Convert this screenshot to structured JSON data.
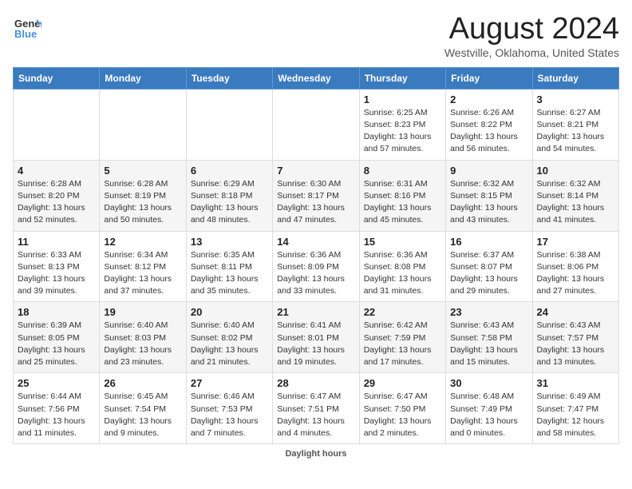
{
  "header": {
    "logo_line1": "General",
    "logo_line2": "Blue",
    "title": "August 2024",
    "subtitle": "Westville, Oklahoma, United States"
  },
  "days_of_week": [
    "Sunday",
    "Monday",
    "Tuesday",
    "Wednesday",
    "Thursday",
    "Friday",
    "Saturday"
  ],
  "footer": {
    "note": "Daylight hours"
  },
  "weeks": [
    {
      "days": [
        {
          "number": "",
          "info": ""
        },
        {
          "number": "",
          "info": ""
        },
        {
          "number": "",
          "info": ""
        },
        {
          "number": "",
          "info": ""
        },
        {
          "number": "1",
          "info": "Sunrise: 6:25 AM\nSunset: 8:23 PM\nDaylight: 13 hours\nand 57 minutes."
        },
        {
          "number": "2",
          "info": "Sunrise: 6:26 AM\nSunset: 8:22 PM\nDaylight: 13 hours\nand 56 minutes."
        },
        {
          "number": "3",
          "info": "Sunrise: 6:27 AM\nSunset: 8:21 PM\nDaylight: 13 hours\nand 54 minutes."
        }
      ]
    },
    {
      "days": [
        {
          "number": "4",
          "info": "Sunrise: 6:28 AM\nSunset: 8:20 PM\nDaylight: 13 hours\nand 52 minutes."
        },
        {
          "number": "5",
          "info": "Sunrise: 6:28 AM\nSunset: 8:19 PM\nDaylight: 13 hours\nand 50 minutes."
        },
        {
          "number": "6",
          "info": "Sunrise: 6:29 AM\nSunset: 8:18 PM\nDaylight: 13 hours\nand 48 minutes."
        },
        {
          "number": "7",
          "info": "Sunrise: 6:30 AM\nSunset: 8:17 PM\nDaylight: 13 hours\nand 47 minutes."
        },
        {
          "number": "8",
          "info": "Sunrise: 6:31 AM\nSunset: 8:16 PM\nDaylight: 13 hours\nand 45 minutes."
        },
        {
          "number": "9",
          "info": "Sunrise: 6:32 AM\nSunset: 8:15 PM\nDaylight: 13 hours\nand 43 minutes."
        },
        {
          "number": "10",
          "info": "Sunrise: 6:32 AM\nSunset: 8:14 PM\nDaylight: 13 hours\nand 41 minutes."
        }
      ]
    },
    {
      "days": [
        {
          "number": "11",
          "info": "Sunrise: 6:33 AM\nSunset: 8:13 PM\nDaylight: 13 hours\nand 39 minutes."
        },
        {
          "number": "12",
          "info": "Sunrise: 6:34 AM\nSunset: 8:12 PM\nDaylight: 13 hours\nand 37 minutes."
        },
        {
          "number": "13",
          "info": "Sunrise: 6:35 AM\nSunset: 8:11 PM\nDaylight: 13 hours\nand 35 minutes."
        },
        {
          "number": "14",
          "info": "Sunrise: 6:36 AM\nSunset: 8:09 PM\nDaylight: 13 hours\nand 33 minutes."
        },
        {
          "number": "15",
          "info": "Sunrise: 6:36 AM\nSunset: 8:08 PM\nDaylight: 13 hours\nand 31 minutes."
        },
        {
          "number": "16",
          "info": "Sunrise: 6:37 AM\nSunset: 8:07 PM\nDaylight: 13 hours\nand 29 minutes."
        },
        {
          "number": "17",
          "info": "Sunrise: 6:38 AM\nSunset: 8:06 PM\nDaylight: 13 hours\nand 27 minutes."
        }
      ]
    },
    {
      "days": [
        {
          "number": "18",
          "info": "Sunrise: 6:39 AM\nSunset: 8:05 PM\nDaylight: 13 hours\nand 25 minutes."
        },
        {
          "number": "19",
          "info": "Sunrise: 6:40 AM\nSunset: 8:03 PM\nDaylight: 13 hours\nand 23 minutes."
        },
        {
          "number": "20",
          "info": "Sunrise: 6:40 AM\nSunset: 8:02 PM\nDaylight: 13 hours\nand 21 minutes."
        },
        {
          "number": "21",
          "info": "Sunrise: 6:41 AM\nSunset: 8:01 PM\nDaylight: 13 hours\nand 19 minutes."
        },
        {
          "number": "22",
          "info": "Sunrise: 6:42 AM\nSunset: 7:59 PM\nDaylight: 13 hours\nand 17 minutes."
        },
        {
          "number": "23",
          "info": "Sunrise: 6:43 AM\nSunset: 7:58 PM\nDaylight: 13 hours\nand 15 minutes."
        },
        {
          "number": "24",
          "info": "Sunrise: 6:43 AM\nSunset: 7:57 PM\nDaylight: 13 hours\nand 13 minutes."
        }
      ]
    },
    {
      "days": [
        {
          "number": "25",
          "info": "Sunrise: 6:44 AM\nSunset: 7:56 PM\nDaylight: 13 hours\nand 11 minutes."
        },
        {
          "number": "26",
          "info": "Sunrise: 6:45 AM\nSunset: 7:54 PM\nDaylight: 13 hours\nand 9 minutes."
        },
        {
          "number": "27",
          "info": "Sunrise: 6:46 AM\nSunset: 7:53 PM\nDaylight: 13 hours\nand 7 minutes."
        },
        {
          "number": "28",
          "info": "Sunrise: 6:47 AM\nSunset: 7:51 PM\nDaylight: 13 hours\nand 4 minutes."
        },
        {
          "number": "29",
          "info": "Sunrise: 6:47 AM\nSunset: 7:50 PM\nDaylight: 13 hours\nand 2 minutes."
        },
        {
          "number": "30",
          "info": "Sunrise: 6:48 AM\nSunset: 7:49 PM\nDaylight: 13 hours\nand 0 minutes."
        },
        {
          "number": "31",
          "info": "Sunrise: 6:49 AM\nSunset: 7:47 PM\nDaylight: 12 hours\nand 58 minutes."
        }
      ]
    }
  ]
}
